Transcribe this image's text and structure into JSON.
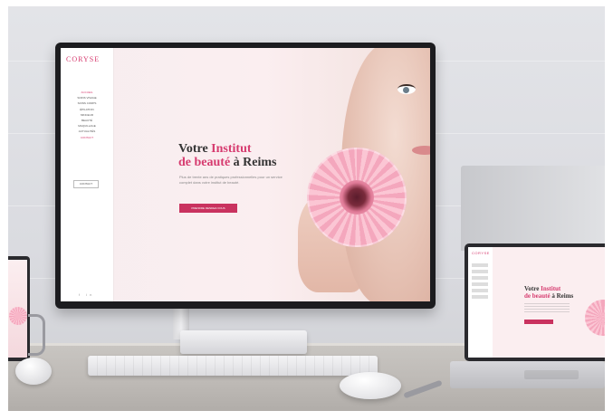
{
  "scene": {
    "description_colors": {
      "accent": "#d63b6f",
      "button": "#c9325f",
      "hero_bg": "#fbeef0"
    }
  },
  "website": {
    "logo": "CORYSE",
    "nav_items": [
      "ACCUEIL",
      "SOINS VISAGE",
      "SOINS CORPS",
      "ÉPILATION",
      "MINCEUR",
      "BEAUTÉ",
      "MAQUILLAGE",
      "ACTUALITÉS",
      "CONTACT"
    ],
    "sidebar_button": "CONTACT",
    "social": "f  in",
    "hero": {
      "title_part1": "Votre ",
      "title_accent1": "Institut",
      "title_part2_accent": "de beauté",
      "title_part2": " à Reims",
      "body": "Plus de trente ans de pratiques professionnelles pour un service complet dans votre institut de beauté.",
      "button": "PRENDRE RENDEZ-VOUS"
    }
  },
  "tablet_site": {
    "logo": "CORYSE",
    "title_part1": "Votre ",
    "title_accent1": "Institut",
    "title_part2_accent": "de beauté",
    "title_part2": " à Reims"
  }
}
